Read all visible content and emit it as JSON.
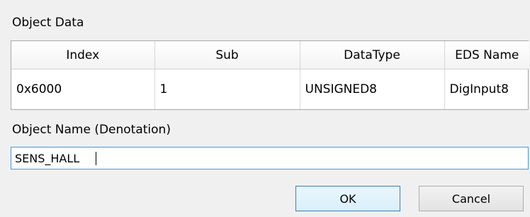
{
  "object_data": {
    "group_label": "Object Data",
    "columns": [
      "Index",
      "Sub",
      "DataType",
      "EDS Name"
    ],
    "rows": [
      [
        "0x6000",
        "1",
        "UNSIGNED8",
        "DigInput8"
      ]
    ]
  },
  "object_name": {
    "label": "Object Name (Denotation)",
    "value": "SENS_HALL"
  },
  "buttons": {
    "ok": "OK",
    "cancel": "Cancel"
  }
}
